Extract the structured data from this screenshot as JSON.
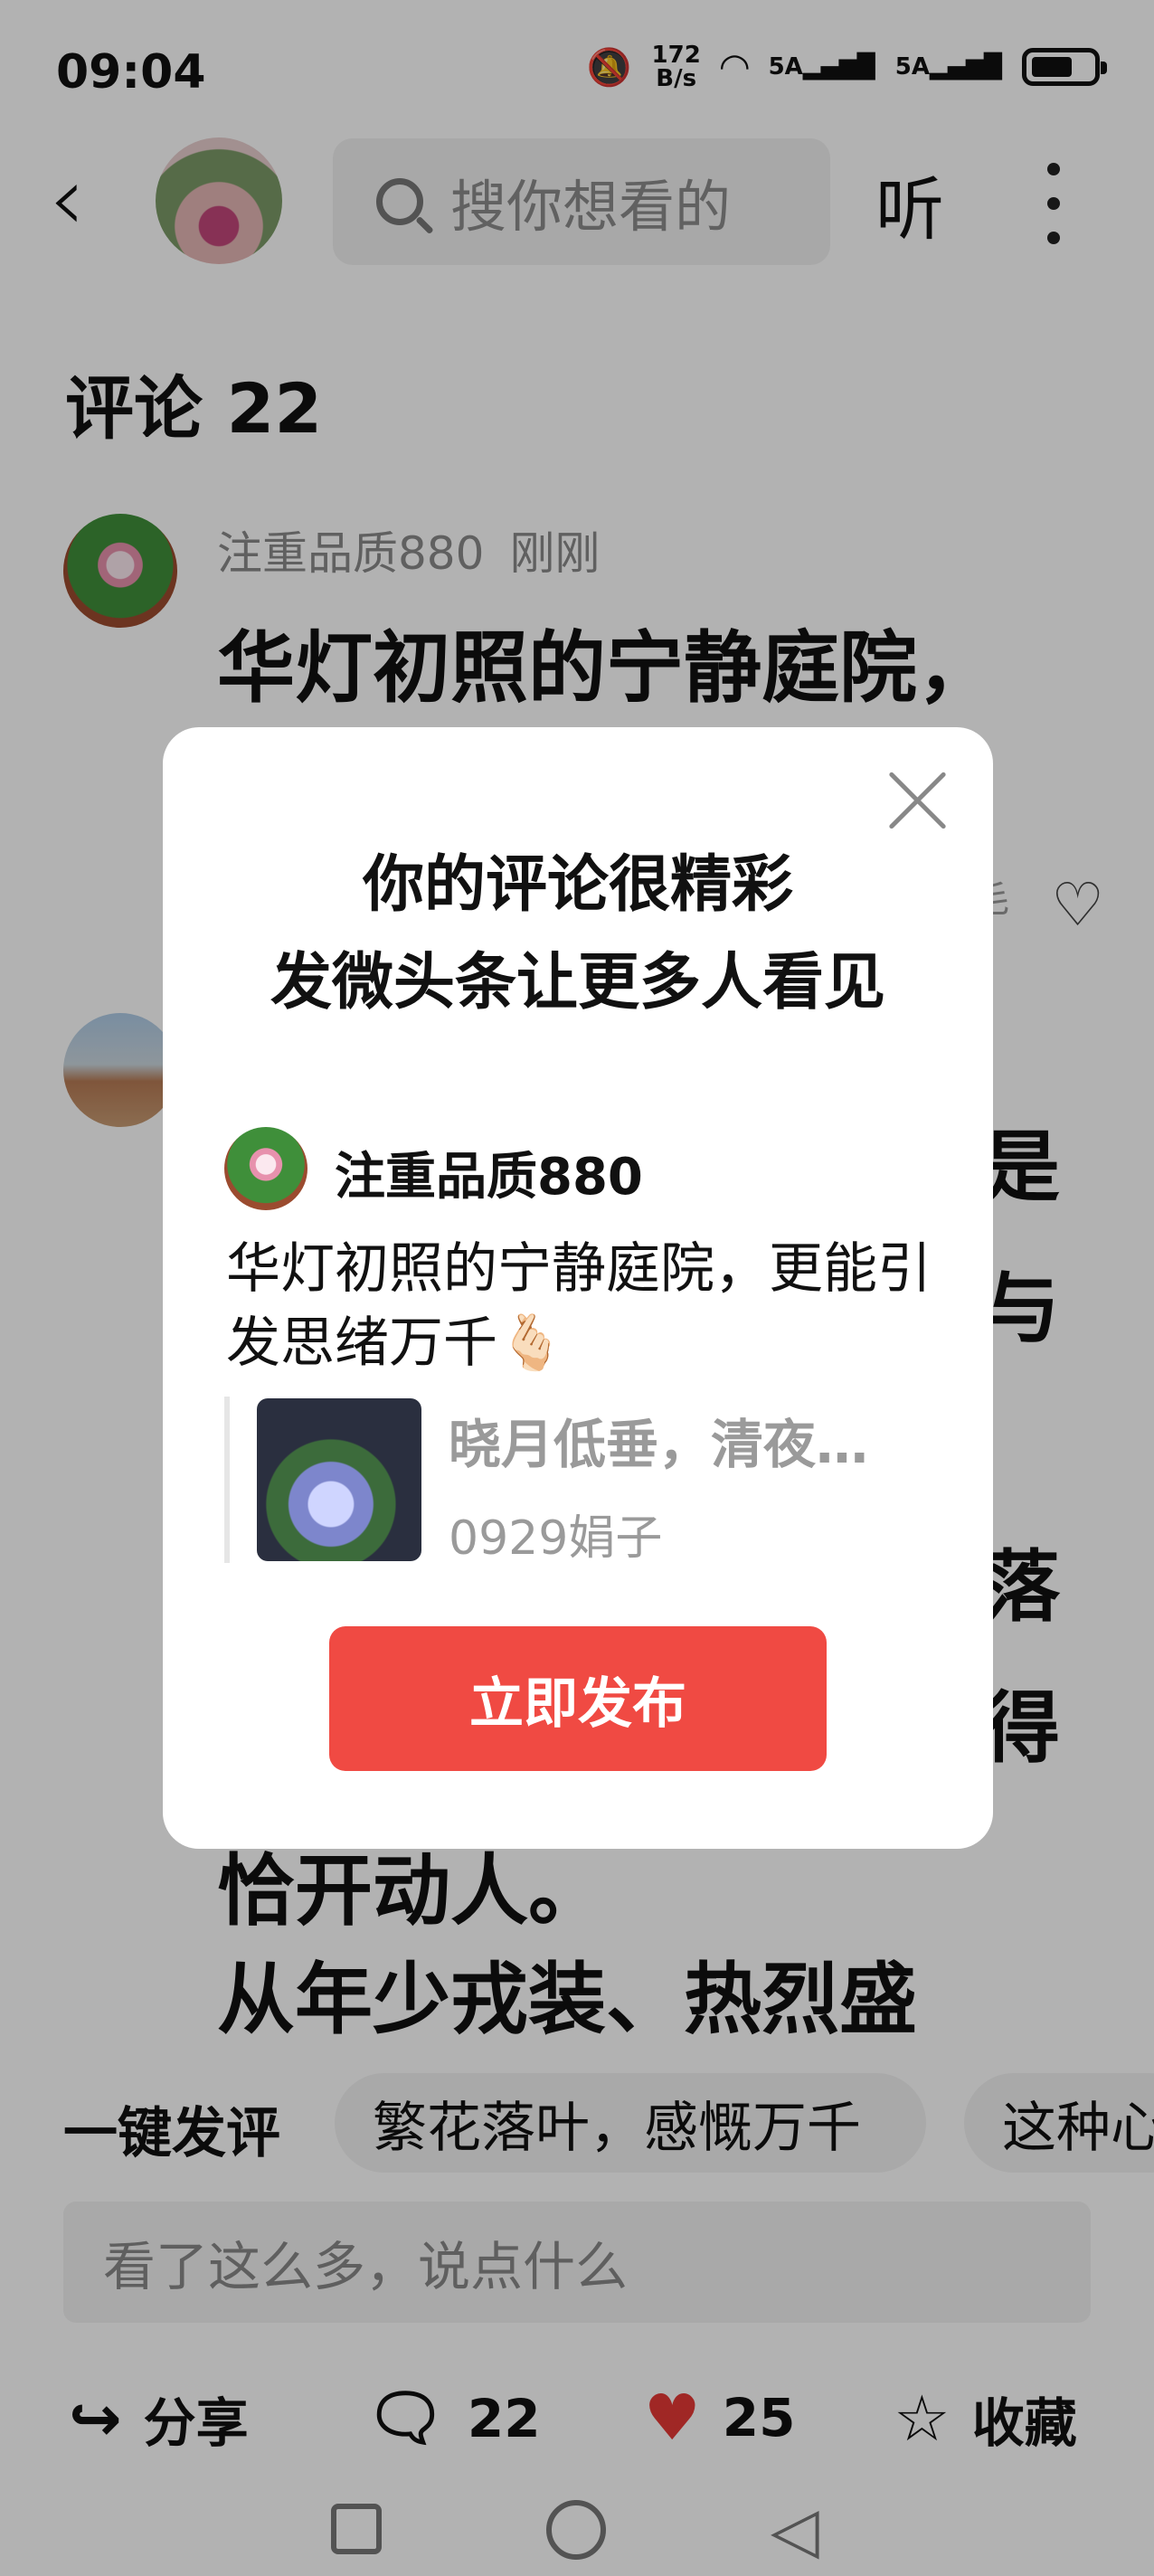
{
  "status_bar": {
    "time": "09:04",
    "net_speed_top": "172",
    "net_speed_unit": "B/s",
    "sim1": "5A",
    "sim2": "5A",
    "icons": [
      "mute-icon",
      "wifi-icon",
      "signal-icon",
      "signal-icon",
      "battery-icon"
    ]
  },
  "header": {
    "back_icon": "chevron-left-icon",
    "search_placeholder": "搜你想看的",
    "listen_label": "听",
    "more_icon": "more-vertical-icon"
  },
  "comments": {
    "title": "评论 22",
    "items": [
      {
        "user": "注重品质880",
        "time": "刚刚",
        "text": "华灯初照的宁静庭院，"
      }
    ],
    "partial_chars": [
      "是",
      "与",
      "落",
      "得"
    ],
    "partial_line_a": "恰开动人。",
    "partial_line_b": "从年少戎装、热烈盛",
    "peek_char": "毛"
  },
  "quick_reply": {
    "label": "一键发评",
    "chips": [
      "繁花落叶，感慨万千",
      "这种心"
    ]
  },
  "comment_input": {
    "placeholder": "看了这么多，说点什么"
  },
  "action_bar": {
    "share_label": "分享",
    "comment_count": "22",
    "like_count": "25",
    "favorite_label": "收藏",
    "like_color": "#e53935"
  },
  "modal": {
    "title_line1": "你的评论很精彩",
    "title_line2": "发微头条让更多人看见",
    "username": "注重品质880",
    "comment_text": "华灯初照的宁静庭院，更能引发思绪万千🫰🏻",
    "ref_title": "晓月低垂，清夜…",
    "ref_author": "0929娟子",
    "publish_button": "立即发布",
    "button_color": "#f04a43"
  }
}
